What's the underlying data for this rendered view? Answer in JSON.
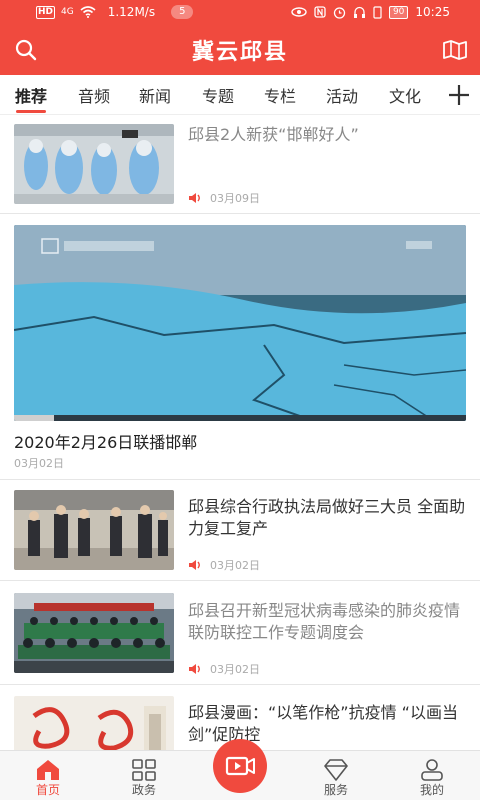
{
  "status_bar": {
    "hd": "HD",
    "signal": "4G",
    "speed": "1.12M/s",
    "notif_count": "5",
    "battery": "90",
    "time": "10:25"
  },
  "header": {
    "title": "冀云邱县",
    "search_icon": "search-icon",
    "map_icon": "map-icon"
  },
  "tabs": [
    {
      "label": "推荐",
      "active": true
    },
    {
      "label": "音频"
    },
    {
      "label": "新闻"
    },
    {
      "label": "专题"
    },
    {
      "label": "专栏"
    },
    {
      "label": "活动"
    },
    {
      "label": "文化"
    }
  ],
  "add_tab_icon": "plus-icon",
  "feed": [
    {
      "title": "邱县2人新获“邯郸好人”",
      "date": "03月09日",
      "audio": true
    },
    {
      "video_title": "2020年2月26日联播邯郸",
      "date": "03月02日",
      "watermark": "邱县融媒体中心"
    },
    {
      "title": "邱县综合行政执法局做好三大员 全面助力复工复产",
      "date": "03月02日",
      "audio": true
    },
    {
      "title": "邱县召开新型冠状病毒感染的肺炎疫情联防联控工作专题调度会",
      "date": "03月02日",
      "audio": true
    },
    {
      "title": "邱县漫画：“以笔作枪”抗疫情 “以画当剑”促防控"
    }
  ],
  "bottom_nav": [
    {
      "label": "首页",
      "icon": "home-icon",
      "active": true
    },
    {
      "label": "政务",
      "icon": "grid-icon"
    },
    {
      "label": "",
      "icon": "video-camera-icon"
    },
    {
      "label": "服务",
      "icon": "diamond-icon"
    },
    {
      "label": "我的",
      "icon": "user-icon"
    }
  ],
  "colors": {
    "accent": "#f04a3e"
  }
}
